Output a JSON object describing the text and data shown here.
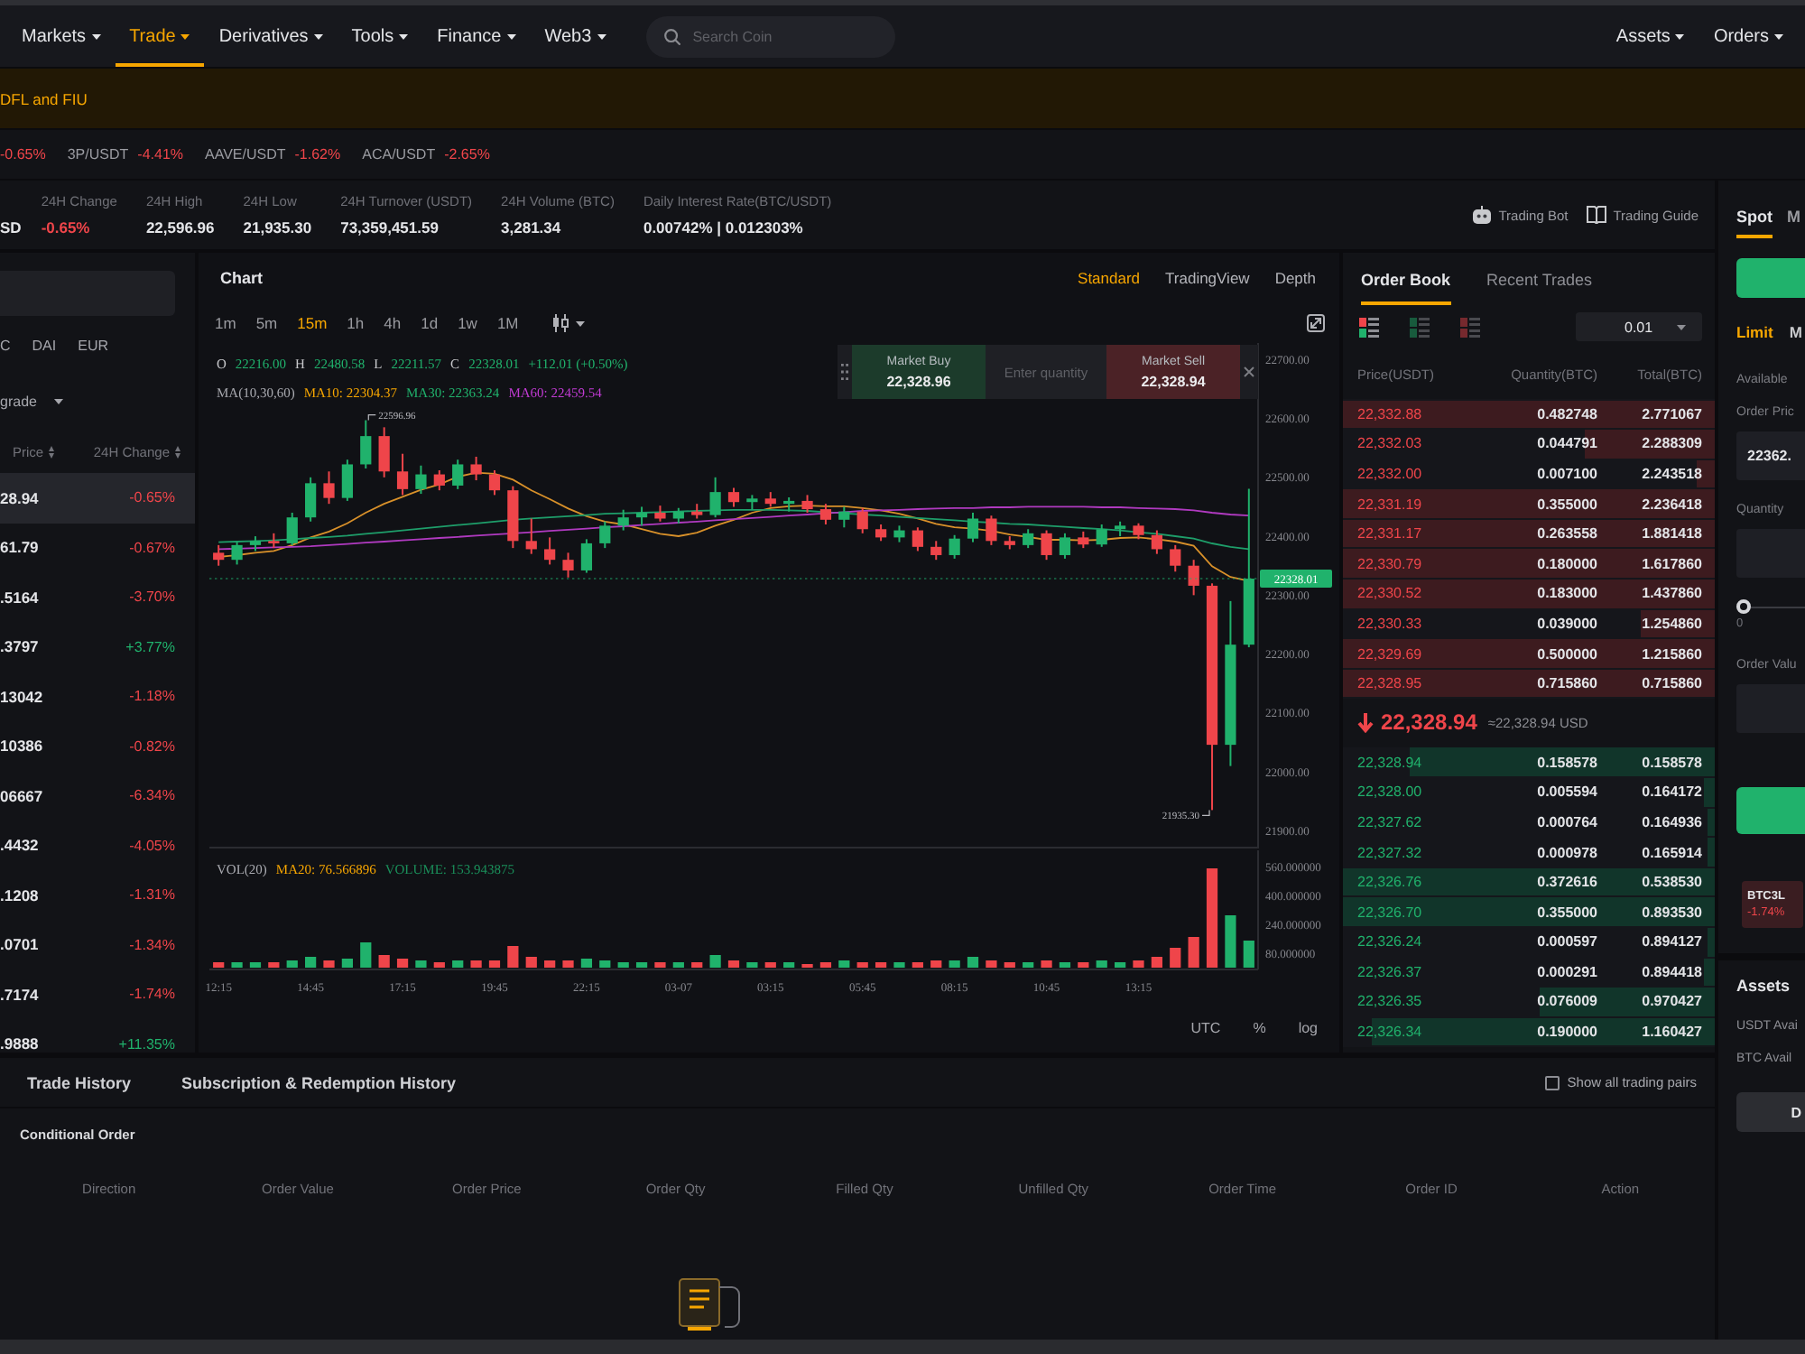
{
  "nav": {
    "items": [
      {
        "label": "Markets",
        "selected": false
      },
      {
        "label": "Trade",
        "selected": true
      },
      {
        "label": "Derivatives",
        "selected": false
      },
      {
        "label": "Tools",
        "selected": false
      },
      {
        "label": "Finance",
        "selected": false
      },
      {
        "label": "Web3",
        "selected": false
      }
    ],
    "search": {
      "placeholder": "Search Coin"
    },
    "right_items": [
      {
        "label": "Assets"
      },
      {
        "label": "Orders"
      }
    ]
  },
  "announcement": {
    "text": "DFL and FIU"
  },
  "ticker": [
    {
      "change": "-0.65%",
      "falling": true
    },
    {
      "pair": "3P/USDT",
      "change": "-4.41%",
      "falling": true
    },
    {
      "pair": "AAVE/USDT",
      "change": "-1.62%",
      "falling": true
    },
    {
      "pair": "ACA/USDT",
      "change": "-2.65%",
      "falling": true
    }
  ],
  "stats": {
    "pair": "SD",
    "change": {
      "label": "24H Change",
      "value": "-0.65%",
      "falling": true
    },
    "items": [
      {
        "label": "24H High",
        "value": "22,596.96"
      },
      {
        "label": "24H Low",
        "value": "21,935.30"
      },
      {
        "label": "24H Turnover (USDT)",
        "value": "73,359,451.59"
      },
      {
        "label": "24H Volume (BTC)",
        "value": "3,281.34"
      },
      {
        "label": "Daily Interest Rate(BTC/USDT)",
        "value": "0.00742% | 0.012303%"
      }
    ],
    "links": [
      {
        "label": "Trading Bot",
        "kind": "bot"
      },
      {
        "label": "Trading Guide",
        "kind": "guide"
      }
    ]
  },
  "market_list": {
    "quote_tabs": [
      {
        "label": "C",
        "selected": false
      },
      {
        "label": "DAI",
        "selected": false
      },
      {
        "label": "EUR",
        "selected": false
      }
    ],
    "filter": "grade",
    "columns": [
      "Price",
      "24H Change"
    ],
    "rows": [
      {
        "price": "28.94",
        "change": "-0.65%",
        "falling": true,
        "selected": true
      },
      {
        "price": "61.79",
        "change": "-0.67%",
        "falling": true,
        "selected": false
      },
      {
        "price": ".5164",
        "change": "-3.70%",
        "falling": true,
        "selected": false
      },
      {
        "price": ".3797",
        "change": "+3.77%",
        "falling": false,
        "selected": false
      },
      {
        "price": "13042",
        "change": "-1.18%",
        "falling": true,
        "selected": false
      },
      {
        "price": "10386",
        "change": "-0.82%",
        "falling": true,
        "selected": false
      },
      {
        "price": "06667",
        "change": "-6.34%",
        "falling": true,
        "selected": false
      },
      {
        "price": ".4432",
        "change": "-4.05%",
        "falling": true,
        "selected": false
      },
      {
        "price": ".1208",
        "change": "-1.31%",
        "falling": true,
        "selected": false
      },
      {
        "price": ".0701",
        "change": "-1.34%",
        "falling": true,
        "selected": false
      },
      {
        "price": ".7174",
        "change": "-1.74%",
        "falling": true,
        "selected": false
      },
      {
        "price": ".9888",
        "change": "+11.35%",
        "falling": false,
        "selected": false
      }
    ]
  },
  "chart": {
    "title": "Chart",
    "views": [
      {
        "label": "Standard",
        "selected": true
      },
      {
        "label": "TradingView",
        "selected": false
      },
      {
        "label": "Depth",
        "selected": false
      }
    ],
    "intervals": [
      {
        "label": "1m",
        "selected": false
      },
      {
        "label": "5m",
        "selected": false
      },
      {
        "label": "15m",
        "selected": true
      },
      {
        "label": "1h",
        "selected": false
      },
      {
        "label": "4h",
        "selected": false
      },
      {
        "label": "1d",
        "selected": false
      },
      {
        "label": "1w",
        "selected": false
      },
      {
        "label": "1M",
        "selected": false
      }
    ],
    "ohlc_legend": {
      "falling": false,
      "items": [
        {
          "key": "O",
          "value": "22216.00"
        },
        {
          "key": "H",
          "value": "22480.58"
        },
        {
          "key": "L",
          "value": "22211.57"
        },
        {
          "key": "C",
          "value": "22328.01"
        }
      ],
      "change": "+112.01 (+0.50%)"
    },
    "ma_legend": {
      "title": "MA(10,30,60)",
      "items": [
        {
          "label": "MA10: 22304.37",
          "color": "#f7a600"
        },
        {
          "label": "MA30: 22363.24",
          "color": "#20b26c"
        },
        {
          "label": "MA60: 22459.54",
          "color": "#c23bd4"
        }
      ]
    },
    "quick_trade": {
      "buy": {
        "label": "Market Buy",
        "price": "22,328.96"
      },
      "quantity": {
        "placeholder": "Enter quantity"
      },
      "sell": {
        "label": "Market Sell",
        "price": "22,328.94"
      }
    },
    "volume_legend": {
      "title": "VOL(20)",
      "items": [
        {
          "label": "MA20: 76.566896",
          "color": "#f7a600"
        },
        {
          "label": "VOLUME: 153.943875",
          "color": "#1a8f5a"
        }
      ]
    },
    "scales": [
      "UTC",
      "%",
      "log"
    ],
    "chart_data": [
      {
        "type": "candlestick",
        "ohlc": [
          [
            22372,
            22385,
            22350,
            22360
          ],
          [
            22360,
            22390,
            22352,
            22385
          ],
          [
            22385,
            22400,
            22375,
            22392
          ],
          [
            22392,
            22405,
            22380,
            22388
          ],
          [
            22388,
            22440,
            22385,
            22432
          ],
          [
            22432,
            22500,
            22425,
            22490
          ],
          [
            22490,
            22510,
            22455,
            22465
          ],
          [
            22465,
            22530,
            22460,
            22522
          ],
          [
            22522,
            22596.96,
            22515,
            22570
          ],
          [
            22570,
            22585,
            22500,
            22510
          ],
          [
            22510,
            22540,
            22470,
            22480
          ],
          [
            22480,
            22520,
            22472,
            22505
          ],
          [
            22505,
            22512,
            22478,
            22486
          ],
          [
            22486,
            22530,
            22480,
            22522
          ],
          [
            22522,
            22535,
            22495,
            22505
          ],
          [
            22505,
            22512,
            22470,
            22478
          ],
          [
            22478,
            22485,
            22380,
            22392
          ],
          [
            22392,
            22430,
            22370,
            22378
          ],
          [
            22378,
            22398,
            22352,
            22360
          ],
          [
            22360,
            22372,
            22330,
            22342
          ],
          [
            22342,
            22395,
            22338,
            22388
          ],
          [
            22388,
            22425,
            22380,
            22418
          ],
          [
            22418,
            22445,
            22410,
            22432
          ],
          [
            22432,
            22450,
            22418,
            22440
          ],
          [
            22440,
            22452,
            22425,
            22430
          ],
          [
            22430,
            22448,
            22422,
            22442
          ],
          [
            22442,
            22455,
            22430,
            22436
          ],
          [
            22436,
            22500,
            22432,
            22475
          ],
          [
            22475,
            22482,
            22450,
            22458
          ],
          [
            22458,
            22470,
            22445,
            22464
          ],
          [
            22464,
            22475,
            22450,
            22455
          ],
          [
            22455,
            22466,
            22442,
            22460
          ],
          [
            22460,
            22470,
            22440,
            22446
          ],
          [
            22446,
            22455,
            22420,
            22428
          ],
          [
            22428,
            22450,
            22415,
            22442
          ],
          [
            22442,
            22448,
            22405,
            22412
          ],
          [
            22412,
            22420,
            22392,
            22398
          ],
          [
            22398,
            22418,
            22390,
            22410
          ],
          [
            22410,
            22415,
            22375,
            22382
          ],
          [
            22382,
            22392,
            22360,
            22368
          ],
          [
            22368,
            22402,
            22362,
            22396
          ],
          [
            22396,
            22440,
            22390,
            22430
          ],
          [
            22430,
            22435,
            22385,
            22392
          ],
          [
            22392,
            22400,
            22378,
            22385
          ],
          [
            22385,
            22412,
            22380,
            22405
          ],
          [
            22405,
            22410,
            22360,
            22368
          ],
          [
            22368,
            22405,
            22362,
            22398
          ],
          [
            22398,
            22408,
            22380,
            22386
          ],
          [
            22386,
            22420,
            22382,
            22412
          ],
          [
            22412,
            22425,
            22400,
            22418
          ],
          [
            22418,
            22422,
            22395,
            22402
          ],
          [
            22402,
            22410,
            22370,
            22378
          ],
          [
            22378,
            22385,
            22340,
            22350
          ],
          [
            22350,
            22360,
            22300,
            22316
          ],
          [
            22316,
            22320,
            21935.3,
            22046
          ],
          [
            22046,
            22290,
            22010,
            22216
          ],
          [
            22216,
            22480.58,
            22211.57,
            22328.01
          ]
        ],
        "series": [
          {
            "type": "line",
            "color": "#d9912a",
            "values": [
              22365,
              22368,
              22372,
              22375,
              22385,
              22398,
              22408,
              22422,
              22440,
              22455,
              22467,
              22479,
              22488,
              22501,
              22508,
              22506,
              22496,
              22478,
              22463,
              22447,
              22434,
              22425,
              22420,
              22412,
              22404,
              22400,
              22406,
              22418,
              22428,
              22440,
              22448,
              22451,
              22452,
              22451,
              22451,
              22448,
              22444,
              22438,
              22430,
              22421,
              22415,
              22413,
              22409,
              22403,
              22399,
              22394,
              22394,
              22393,
              22394,
              22397,
              22398,
              22395,
              22391,
              22384,
              22349,
              22331,
              22324
            ]
          },
          {
            "type": "line",
            "color": "#1e9e6a",
            "values": [
              22390,
              22391,
              22392,
              22393,
              22395,
              22397,
              22399,
              22401,
              22404,
              22407,
              22410,
              22413,
              22416,
              22419,
              22422,
              22425,
              22428,
              22430,
              22432,
              22434,
              22436,
              22438,
              22439,
              22440,
              22441,
              22442,
              22443,
              22444,
              22445,
              22445,
              22445,
              22444,
              22443,
              22441,
              22439,
              22437,
              22435,
              22433,
              22431,
              22429,
              22427,
              22425,
              22423,
              22421,
              22420,
              22418,
              22416,
              22414,
              22412,
              22410,
              22407,
              22404,
              22400,
              22396,
              22388,
              22382,
              22378
            ]
          },
          {
            "type": "line",
            "color": "#b03ac0",
            "values": [
              22378,
              22379,
              22380,
              22381,
              22382,
              22383,
              22385,
              22387,
              22389,
              22391,
              22393,
              22395,
              22397,
              22399,
              22401,
              22403,
              22405,
              22407,
              22409,
              22411,
              22413,
              22415,
              22417,
              22419,
              22421,
              22423,
              22425,
              22427,
              22429,
              22431,
              22433,
              22435,
              22437,
              22439,
              22441,
              22443,
              22444,
              22445,
              22446,
              22447,
              22448,
              22448,
              22449,
              22449,
              22450,
              22450,
              22450,
              22450,
              22449,
              22449,
              22448,
              22447,
              22446,
              22444,
              22440,
              22437,
              22435
            ]
          }
        ],
        "ylim": [
          21870,
          22728
        ],
        "yticks": [
          {
            "value": 22700,
            "label": "22700.00"
          },
          {
            "value": 22600,
            "label": "22600.00"
          },
          {
            "value": 22500,
            "label": "22500.00"
          },
          {
            "value": 22400,
            "label": "22400.00"
          },
          {
            "value": 22300,
            "label": "22300.00"
          },
          {
            "value": 22200,
            "label": "22200.00"
          },
          {
            "value": 22100,
            "label": "22100.00"
          },
          {
            "value": 22000,
            "label": "22000.00"
          },
          {
            "value": 21900,
            "label": "21900.00"
          }
        ],
        "tick_labels": "y",
        "ref_lines": [
          {
            "axis": "y",
            "value": 22328.01,
            "label": "22328.01",
            "color": "#20b26c",
            "line_style": "dotted"
          }
        ],
        "annotations": [
          "22596.96",
          "21935.30"
        ]
      },
      {
        "type": "bar",
        "categories": [
          "12:15",
          null,
          null,
          null,
          null,
          "14:45",
          null,
          null,
          null,
          null,
          "17:15",
          null,
          null,
          null,
          null,
          "19:45",
          null,
          null,
          null,
          null,
          "22:15",
          null,
          null,
          null,
          null,
          "03-07",
          null,
          null,
          null,
          null,
          "03:15",
          null,
          null,
          null,
          null,
          "05:45",
          null,
          null,
          null,
          null,
          "08:15",
          null,
          null,
          null,
          null,
          "10:45",
          null,
          null,
          null,
          null,
          "13:15",
          null,
          null,
          null,
          null,
          null,
          null
        ],
        "values": [
          30,
          30,
          30,
          30,
          40,
          60,
          40,
          50,
          140,
          70,
          50,
          40,
          30,
          40,
          40,
          40,
          120,
          60,
          40,
          40,
          50,
          40,
          30,
          30,
          30,
          30,
          30,
          70,
          40,
          30,
          30,
          30,
          20,
          30,
          40,
          30,
          30,
          30,
          30,
          40,
          40,
          60,
          40,
          30,
          30,
          40,
          30,
          30,
          40,
          30,
          40,
          60,
          110,
          170,
          550,
          290,
          150
        ],
        "colors": [
          "#ef454a",
          "#20b26c",
          "#20b26c",
          "#ef454a",
          "#20b26c",
          "#20b26c",
          "#ef454a",
          "#20b26c",
          "#20b26c",
          "#ef454a",
          "#ef454a",
          "#20b26c",
          "#ef454a",
          "#20b26c",
          "#ef454a",
          "#ef454a",
          "#ef454a",
          "#ef454a",
          "#ef454a",
          "#ef454a",
          "#20b26c",
          "#20b26c",
          "#20b26c",
          "#20b26c",
          "#ef454a",
          "#20b26c",
          "#ef454a",
          "#20b26c",
          "#ef454a",
          "#20b26c",
          "#ef454a",
          "#20b26c",
          "#ef454a",
          "#ef454a",
          "#20b26c",
          "#ef454a",
          "#ef454a",
          "#20b26c",
          "#ef454a",
          "#ef454a",
          "#20b26c",
          "#20b26c",
          "#ef454a",
          "#ef454a",
          "#20b26c",
          "#ef454a",
          "#20b26c",
          "#ef454a",
          "#20b26c",
          "#20b26c",
          "#ef454a",
          "#ef454a",
          "#ef454a",
          "#ef454a",
          "#ef454a",
          "#20b26c",
          "#20b26c"
        ],
        "ylim": [
          0,
          640
        ],
        "yticks": [
          {
            "value": 560,
            "label": "560.000000"
          },
          {
            "value": 400,
            "label": "400.000000"
          },
          {
            "value": 240,
            "label": "240.000000"
          },
          {
            "value": 80,
            "label": "80.000000"
          }
        ]
      }
    ]
  },
  "order_book": {
    "tabs": [
      {
        "label": "Order Book",
        "selected": true
      },
      {
        "label": "Recent Trades",
        "selected": false
      }
    ],
    "views": [
      {
        "kind": "both",
        "selected": true
      },
      {
        "kind": "bids",
        "selected": false
      },
      {
        "kind": "asks",
        "selected": false
      }
    ],
    "precision": "0.01",
    "columns": [
      "Price(USDT)",
      "Quantity(BTC)",
      "Total(BTC)"
    ],
    "asks": [
      {
        "price": "22,332.88",
        "quantity": "0.482748",
        "total": "2.771067",
        "level": 1
      },
      {
        "price": "22,332.03",
        "quantity": "0.044791",
        "total": "2.288309",
        "level": 0.35
      },
      {
        "price": "22,332.00",
        "quantity": "0.007100",
        "total": "2.243518",
        "level": 0.05
      },
      {
        "price": "22,331.19",
        "quantity": "0.355000",
        "total": "2.236418",
        "level": 1
      },
      {
        "price": "22,331.17",
        "quantity": "0.263558",
        "total": "1.881418",
        "level": 1
      },
      {
        "price": "22,330.79",
        "quantity": "0.180000",
        "total": "1.617860",
        "level": 1
      },
      {
        "price": "22,330.52",
        "quantity": "0.183000",
        "total": "1.437860",
        "level": 1
      },
      {
        "price": "22,330.33",
        "quantity": "0.039000",
        "total": "1.254860",
        "level": 0.2
      },
      {
        "price": "22,329.69",
        "quantity": "0.500000",
        "total": "1.215860",
        "level": 1
      },
      {
        "price": "22,328.95",
        "quantity": "0.715860",
        "total": "0.715860",
        "level": 1
      }
    ],
    "last_price": {
      "value": "22,328.94",
      "usd": "≈22,328.94 USD",
      "falling": true
    },
    "bids": [
      {
        "price": "22,328.94",
        "quantity": "0.158578",
        "total": "0.158578",
        "level": 0.82
      },
      {
        "price": "22,328.00",
        "quantity": "0.005594",
        "total": "0.164172",
        "level": 0.03
      },
      {
        "price": "22,327.62",
        "quantity": "0.000764",
        "total": "0.164936",
        "level": 0.02
      },
      {
        "price": "22,327.32",
        "quantity": "0.000978",
        "total": "0.165914",
        "level": 0.02
      },
      {
        "price": "22,326.76",
        "quantity": "0.372616",
        "total": "0.538530",
        "level": 1
      },
      {
        "price": "22,326.70",
        "quantity": "0.355000",
        "total": "0.893530",
        "level": 1
      },
      {
        "price": "22,326.24",
        "quantity": "0.000597",
        "total": "0.894127",
        "level": 0.02
      },
      {
        "price": "22,326.37",
        "quantity": "0.000291",
        "total": "0.894418",
        "level": 0.03
      },
      {
        "price": "22,326.35",
        "quantity": "0.076009",
        "total": "0.970427",
        "level": 0.47
      },
      {
        "price": "22,326.34",
        "quantity": "0.190000",
        "total": "1.160427",
        "level": 0.92
      }
    ]
  },
  "trade_panel": {
    "tabs": [
      {
        "label": "Spot",
        "selected": true
      },
      {
        "label": "M",
        "selected": false
      }
    ],
    "side_toggle": {
      "selected": true
    },
    "order_types": [
      {
        "label": "Limit",
        "selected": true
      },
      {
        "label": "M",
        "selected": false
      }
    ],
    "available": "Available",
    "price": {
      "label": "Order Pric",
      "value": "22362."
    },
    "quantity": {
      "label": "Quantity"
    },
    "slider": {
      "level": 0,
      "reading": "0"
    },
    "order_value": {
      "label": "Order Valu"
    },
    "promo": {
      "symbol": "BTC3L",
      "change": "-1.74%",
      "falling": true
    }
  },
  "assets": {
    "title": "Assets",
    "lines": [
      "USDT Avai",
      "BTC Avail"
    ],
    "button": "D"
  },
  "orders": {
    "tabs": [
      {
        "label": "Trade History",
        "selected": false
      },
      {
        "label": "Subscription & Redemption History",
        "selected": false
      }
    ],
    "show_all": {
      "label": "Show all trading pairs",
      "checked": false
    },
    "subtabs": [
      {
        "label": "Conditional Order",
        "selected": true
      }
    ],
    "columns": [
      "Direction",
      "Order Value",
      "Order Price",
      "Order Qty",
      "Filled Qty",
      "Unfilled Qty",
      "Order Time",
      "Order ID",
      "Action"
    ]
  }
}
